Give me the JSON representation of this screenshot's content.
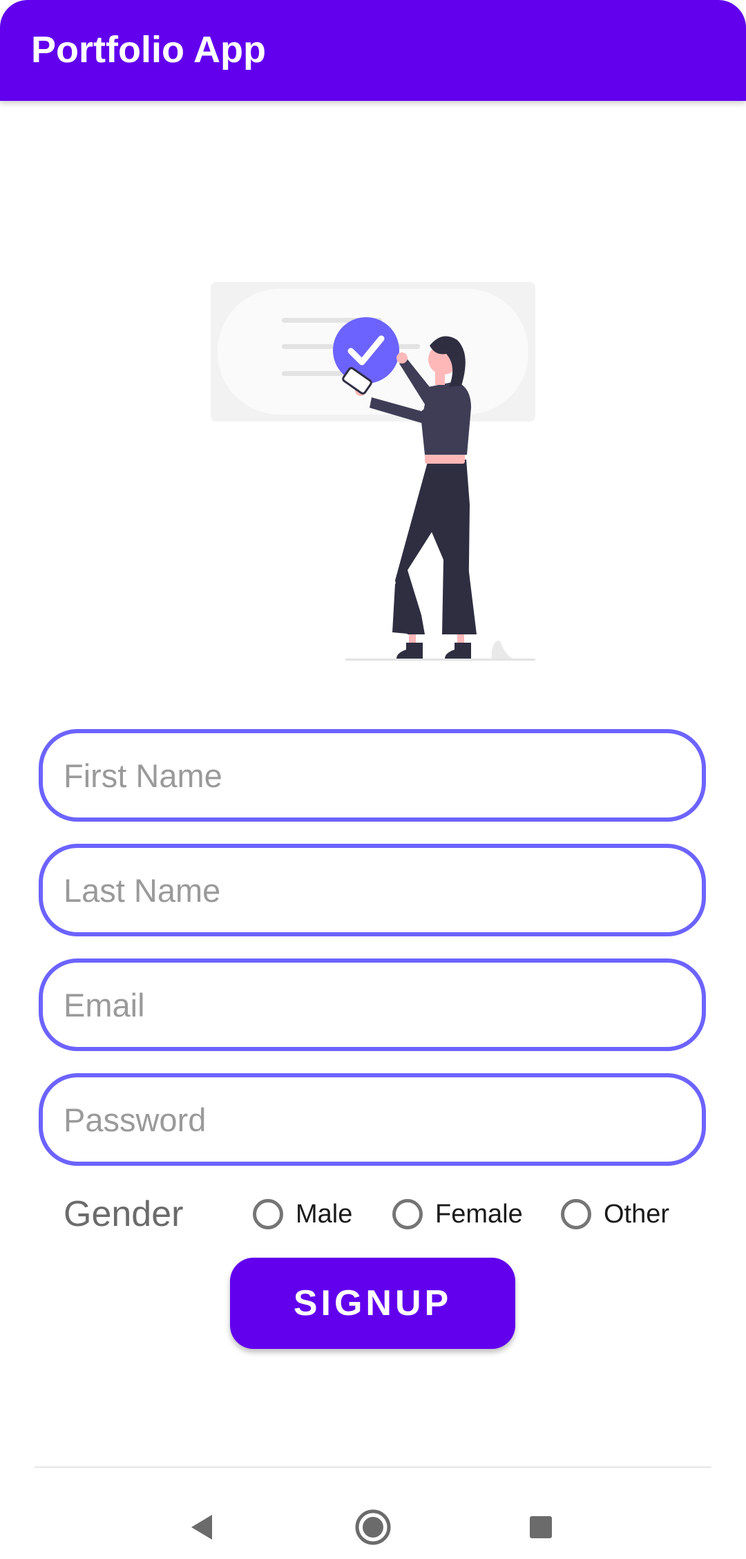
{
  "app_bar": {
    "title": "Portfolio App",
    "color": "#6200EE"
  },
  "illustration": {
    "name": "woman-checking-list-illustration",
    "accent_color": "#6C63FF"
  },
  "form": {
    "first_name": {
      "placeholder": "First Name",
      "value": ""
    },
    "last_name": {
      "placeholder": "Last Name",
      "value": ""
    },
    "email": {
      "placeholder": "Email",
      "value": ""
    },
    "password": {
      "placeholder": "Password",
      "value": ""
    },
    "field_border_color": "#6C63FF",
    "gender": {
      "label": "Gender",
      "options": [
        "Male",
        "Female",
        "Other"
      ],
      "selected": null
    },
    "submit_label": "SIGNUP"
  },
  "nav_bar": {
    "buttons": [
      "back-icon",
      "home-icon",
      "recents-icon"
    ]
  }
}
